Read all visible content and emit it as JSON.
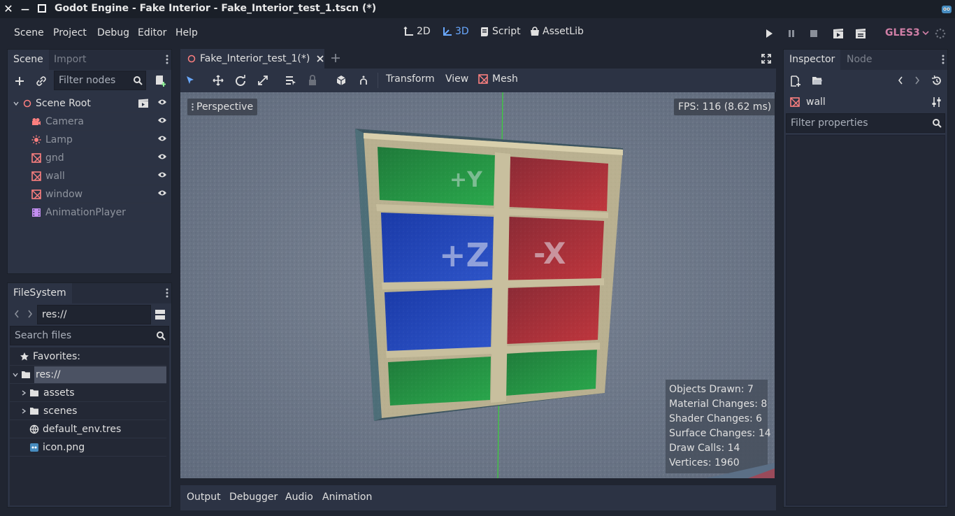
{
  "window": {
    "title": "Godot Engine - Fake Interior - Fake_Interior_test_1.tscn (*)",
    "close_glyph": "✕",
    "minimize_glyph": "—"
  },
  "menu": {
    "items": [
      "Scene",
      "Project",
      "Debug",
      "Editor",
      "Help"
    ]
  },
  "workspaces": {
    "twod": "2D",
    "threed": "3D",
    "script": "Script",
    "assetlib": "AssetLib",
    "active": "3D"
  },
  "renderer": "GLES3",
  "scene_dock": {
    "tabs": [
      "Scene",
      "Import"
    ],
    "filter_placeholder": "Filter nodes",
    "nodes": [
      {
        "name": "Scene Root",
        "icon": "spatial-icon",
        "visible_toggle": true,
        "root": true
      },
      {
        "name": "Camera",
        "icon": "camera-icon",
        "visible_toggle": true
      },
      {
        "name": "Lamp",
        "icon": "light-icon",
        "visible_toggle": true
      },
      {
        "name": "gnd",
        "icon": "mesh-instance-icon",
        "visible_toggle": true
      },
      {
        "name": "wall",
        "icon": "mesh-instance-icon",
        "visible_toggle": true
      },
      {
        "name": "window",
        "icon": "mesh-instance-icon",
        "visible_toggle": true
      },
      {
        "name": "AnimationPlayer",
        "icon": "animation-player-icon",
        "visible_toggle": false
      }
    ]
  },
  "filesystem": {
    "tab": "FileSystem",
    "path": "res://",
    "search_placeholder": "Search files",
    "favorites": "Favorites:",
    "root": "res://",
    "folders": [
      "assets",
      "scenes"
    ],
    "files": [
      "default_env.tres",
      "icon.png"
    ]
  },
  "editor_tab": {
    "label": "Fake_Interior_test_1(*)"
  },
  "viewport_toolbar": {
    "transform": "Transform",
    "view": "View",
    "mesh": "Mesh"
  },
  "viewport": {
    "perspective": "Perspective",
    "fps": "FPS: 116 (8.62 ms)",
    "stats": [
      "Objects Drawn: 7",
      "Material Changes: 8",
      "Shader Changes: 6",
      "Surface Changes: 14",
      "Draw Calls: 14",
      "Vertices: 1960"
    ],
    "cube_labels": [
      "+Z",
      "-X",
      "+Y"
    ]
  },
  "bottom_panel": {
    "tabs": [
      "Output",
      "Debugger",
      "Audio",
      "Animation"
    ]
  },
  "inspector": {
    "tabs": [
      "Inspector",
      "Node"
    ],
    "object": "wall",
    "filter_placeholder": "Filter properties"
  },
  "colors": {
    "accent": "#6aa9ff",
    "background": "#202531",
    "panel": "#262c3b",
    "renderer": "#d07fa6",
    "node_icon": "#fc7f7f"
  }
}
